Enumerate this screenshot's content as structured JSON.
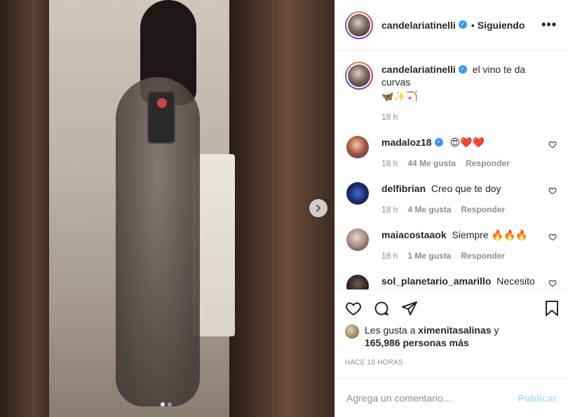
{
  "post": {
    "username": "candelariatinelli",
    "follow_status": "Siguiendo",
    "dot": "•",
    "more": "•••",
    "caption": "el vino te da curvas",
    "caption_emoji": "🦋✨🏹",
    "caption_time": "18 h"
  },
  "comments": [
    {
      "user": "madaloz18",
      "text": "😍❤️❤️",
      "time": "18 h",
      "likes": "44 Me gusta",
      "reply": "Responder",
      "verified": true,
      "avatar_color": "#7a4a3a"
    },
    {
      "user": "delfibrian",
      "text": "Creo que te doy",
      "time": "18 h",
      "likes": "4 Me gusta",
      "reply": "Responder",
      "verified": false,
      "avatar_color": "#1d2a6b"
    },
    {
      "user": "maiacostaaok",
      "text": "Siempre 🔥🔥🔥",
      "time": "18 h",
      "likes": "1 Me gusta",
      "reply": "Responder",
      "verified": false,
      "avatar_color": "#c7b3a6"
    },
    {
      "user": "sol_planetario_amarillo",
      "text": "Necesito un tutorial de como pensas tus",
      "verified": false,
      "avatar_color": "#2a1e1a"
    }
  ],
  "likes": {
    "prefix": "Les gusta a",
    "first_user": "ximenitasalinas",
    "connector": "y",
    "others": "165,986 personas más"
  },
  "timestamp": "HACE 18 HORAS",
  "comment_box": {
    "placeholder": "Agrega un comentario...",
    "publish": "Publicar"
  },
  "photo": {
    "next_icon": "chevron-right-icon",
    "slides": 2,
    "active_slide": 1
  },
  "colors": {
    "verified": "#3897f0",
    "publish_disabled": "#b2dffc",
    "muted": "#8e8e8e"
  }
}
